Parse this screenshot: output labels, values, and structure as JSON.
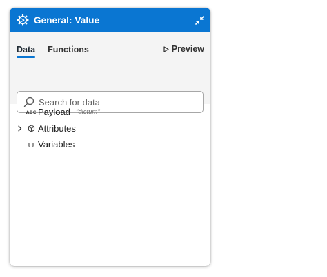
{
  "header": {
    "title": "General: Value",
    "accent": "#0a76d2"
  },
  "tabs": [
    {
      "label": "Data",
      "active": true
    },
    {
      "label": "Functions",
      "active": false
    }
  ],
  "preview": {
    "label": "Preview"
  },
  "search": {
    "placeholder": "Search for data",
    "value": ""
  },
  "tree": {
    "items": [
      {
        "label": "Payload",
        "hint": "\"dictum\"",
        "type_glyph": "ABC",
        "icon": "string-type-icon",
        "expandable": false
      },
      {
        "label": "Attributes",
        "icon": "cube-icon",
        "expandable": true
      },
      {
        "label": "Variables",
        "type_glyph": "[ ]",
        "icon": "brackets-icon",
        "expandable": false
      }
    ]
  }
}
